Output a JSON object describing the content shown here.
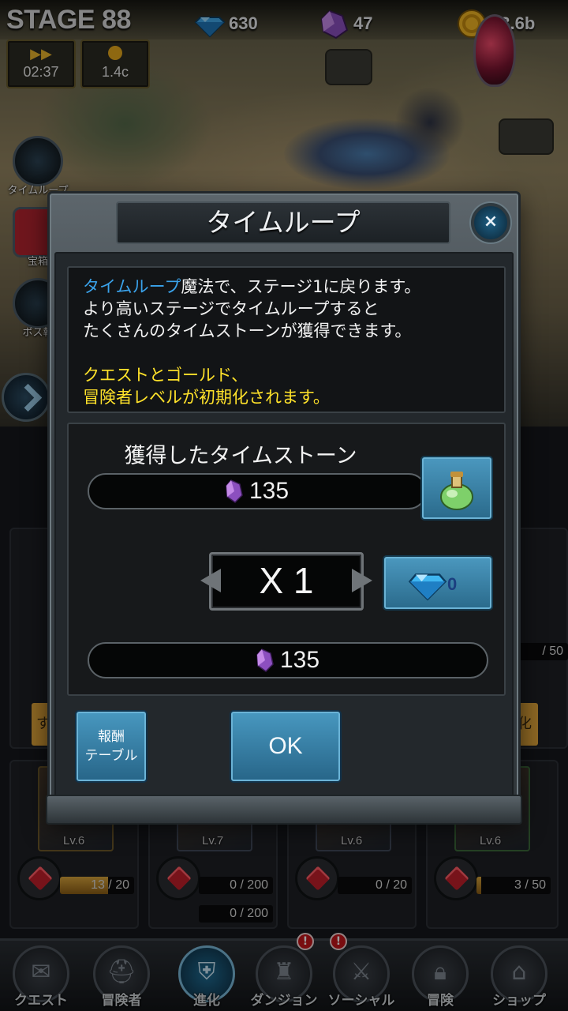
{
  "hud": {
    "stage_label": "STAGE 88",
    "gems": "630",
    "crystals": "47",
    "gold": "23.6b",
    "speed_timer": "02:37",
    "gold_rate": "1.4c"
  },
  "side_buttons": [
    {
      "label": "タイムループ",
      "icon": "hourglass-icon"
    },
    {
      "label": "宝箱",
      "icon": "treasure-chest-icon"
    },
    {
      "label": "ボス報",
      "icon": "boss-reward-icon"
    }
  ],
  "dialog": {
    "title": "タイムループ",
    "close_label": "×",
    "desc_highlight": "タイムループ",
    "desc_line1_rest": "魔法で、ステージ1に戻ります。",
    "desc_line2": "より高いステージでタイムループすると",
    "desc_line3": "たくさんのタイムストーンが獲得できます。",
    "warn_line1": "クエストとゴールド、",
    "warn_line2": "冒険者レベルが初期化されます。",
    "earned_header": "獲得したタイムストーン",
    "earned_value": "135",
    "multiplier": "X 1",
    "gem_cost": "0",
    "total_value": "135",
    "reward_table_line1": "報酬",
    "reward_table_line2": "テーブル",
    "ok_label": "OK"
  },
  "cards": [
    {
      "level": "Lv.6",
      "progress": "13 / 20",
      "fill": 0.65
    },
    {
      "level": "Lv.7",
      "progress": "0 / 200",
      "progress2": "0 / 200",
      "fill": 0
    },
    {
      "level": "Lv.6",
      "progress": "0 / 20",
      "fill": 0
    },
    {
      "level": "Lv.6",
      "progress": "3 / 50",
      "fill": 0.06
    }
  ],
  "right_partial": {
    "progress": "/ 50",
    "tab_text": "化"
  },
  "left_partial": {
    "tab_text": "す"
  },
  "nav": [
    {
      "label": "クエスト",
      "icon": "quest-scroll-icon",
      "alert": false,
      "active": false
    },
    {
      "label": "冒険者",
      "icon": "helmet-icon",
      "alert": false,
      "active": false
    },
    {
      "label": "進化",
      "icon": "evolution-shield-icon",
      "alert": false,
      "active": true
    },
    {
      "label": "ダンジョン",
      "icon": "castle-icon",
      "alert": true,
      "active": false
    },
    {
      "label": "ソーシャル",
      "icon": "crossed-swords-icon",
      "alert": true,
      "active": false
    },
    {
      "label": "冒険",
      "icon": "lock-icon",
      "alert": false,
      "active": false
    },
    {
      "label": "ショップ",
      "icon": "shop-icon",
      "alert": false,
      "active": false
    }
  ],
  "alert_mark": "!",
  "colors": {
    "highlight": "#3aa2ea",
    "warning": "#ffe22a",
    "button": "#3a84ac"
  }
}
